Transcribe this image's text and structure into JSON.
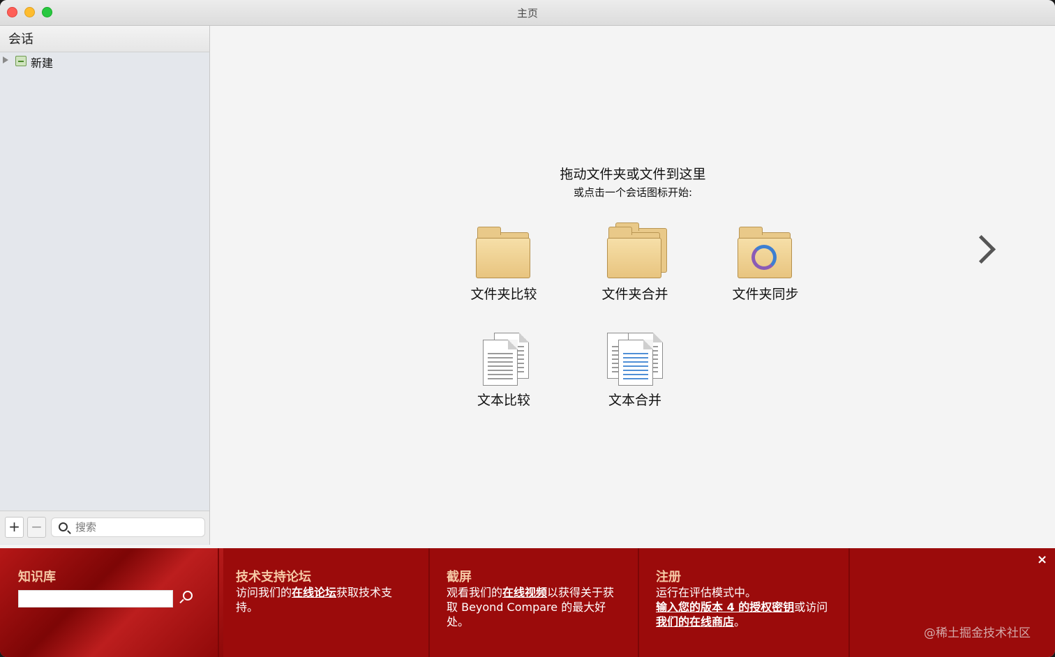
{
  "window": {
    "title": "主页"
  },
  "sidebar": {
    "header": "会话",
    "items": [
      {
        "label": "新建"
      }
    ],
    "add_label": "+",
    "remove_label": "−",
    "search_placeholder": "搜索"
  },
  "main": {
    "drop_title": "拖动文件夹或文件到这里",
    "drop_subtitle": "或点击一个会话图标开始:",
    "sessions": [
      {
        "label": "文件夹比较",
        "icon": "folder-compare-icon"
      },
      {
        "label": "文件夹合并",
        "icon": "folder-merge-icon"
      },
      {
        "label": "文件夹同步",
        "icon": "folder-sync-icon"
      },
      {
        "label": "文本比较",
        "icon": "text-compare-icon"
      },
      {
        "label": "文本合并",
        "icon": "text-merge-icon"
      }
    ]
  },
  "knowledge_bar": {
    "kb_title": "知识库",
    "forum_title": "技术支持论坛",
    "forum_text_1": "访问我们的",
    "forum_link": "在线论坛",
    "forum_text_2": "获取技术支持。",
    "screen_title": "截屏",
    "screen_text_1": "观看我们的",
    "screen_link": "在线视频",
    "screen_text_2": "以获得关于获取 Beyond Compare 的最大好处。",
    "register_title": "注册",
    "register_text_1": "运行在评估模式中。",
    "register_link_1": "输入您的版本 4 的授权密钥",
    "register_text_2": "或访问",
    "register_link_2": "我们的在线商店",
    "register_text_3": "。",
    "close_label": "×",
    "watermark": "@稀土掘金技术社区"
  }
}
